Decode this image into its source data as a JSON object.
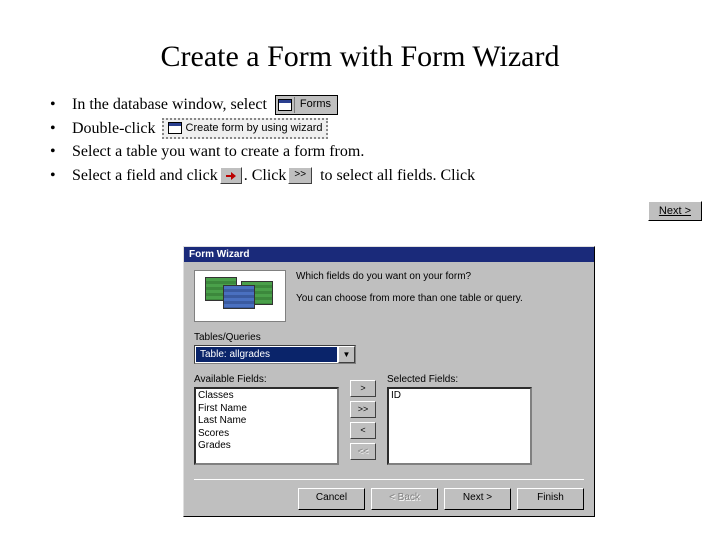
{
  "title": "Create a Form with Form Wizard",
  "bullets": {
    "b1a": "In the database window, select",
    "forms_tab": "Forms",
    "b2a": "Double-click",
    "create_link": "Create form by using wizard",
    "b3": "Select a table you want to create a form from.",
    "b4a": "Select a field and click",
    "b4b": ".  Click",
    "b4c": "to select all fields.  Click",
    "gtgt": ">>"
  },
  "next_btn": "Next >",
  "wizard": {
    "title": "Form Wizard",
    "q1": "Which fields do you want on your form?",
    "q2": "You can choose from more than one table or query.",
    "tables_label": "Tables/Queries",
    "combo_value": "Table: allgrades",
    "avail_label": "Available Fields:",
    "sel_label": "Selected Fields:",
    "available": [
      "Classes",
      "First Name",
      "Last Name",
      "Scores",
      "Grades"
    ],
    "selected": [
      "ID"
    ],
    "midbtns": {
      "gt": ">",
      "gtgt": ">>",
      "lt": "<",
      "ltlt": "<<"
    },
    "buttons": {
      "cancel": "Cancel",
      "back": "< Back",
      "next": "Next >",
      "finish": "Finish"
    }
  }
}
